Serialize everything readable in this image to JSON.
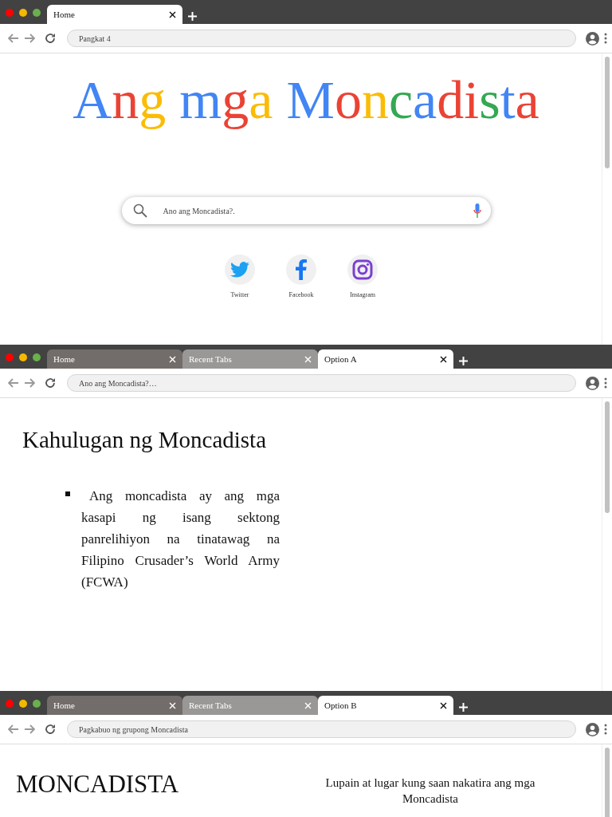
{
  "windows": [
    {
      "tabs": [
        {
          "label": "Home",
          "selected": true,
          "color": "#ffffff"
        }
      ],
      "address": "Pangkat 4",
      "content": {
        "kind": "search",
        "logo": [
          {
            "letters": [
              {
                "text": "A",
                "color": "#4285f4"
              },
              {
                "text": "n",
                "color": "#ea4335"
              },
              {
                "text": "g",
                "color": "#fbbc05"
              }
            ]
          },
          {
            "letters": [
              {
                "text": "m",
                "color": "#4285f4"
              },
              {
                "text": "g",
                "color": "#ea4335"
              },
              {
                "text": "a",
                "color": "#fbbc05"
              }
            ]
          },
          {
            "letters": [
              {
                "text": "M",
                "color": "#4285f4"
              },
              {
                "text": "o",
                "color": "#ea4335"
              },
              {
                "text": "n",
                "color": "#fbbc05"
              },
              {
                "text": "c",
                "color": "#34a853"
              },
              {
                "text": "a",
                "color": "#4285f4"
              },
              {
                "text": "d",
                "color": "#ea4335"
              },
              {
                "text": "i",
                "color": "#ea4335"
              },
              {
                "text": "s",
                "color": "#34a853"
              },
              {
                "text": "t",
                "color": "#4285f4"
              },
              {
                "text": "a",
                "color": "#ea4335"
              }
            ]
          }
        ],
        "query": "Ano ang Moncadista?.",
        "shortcuts": [
          {
            "kind": "twitter",
            "label": "Twitter"
          },
          {
            "kind": "facebook",
            "label": "Facebook"
          },
          {
            "kind": "instagram",
            "label": "Instagram"
          }
        ]
      }
    },
    {
      "tabs": [
        {
          "label": "Home",
          "selected": false,
          "color": "#726d6b"
        },
        {
          "label": "Recent Tabs",
          "selected": false,
          "color": "#9a9896"
        },
        {
          "label": "Option A",
          "selected": true,
          "color": "#ffffff"
        }
      ],
      "address": "Ano ang Moncadista?…",
      "content": {
        "kind": "article",
        "title": "Kahulugan ng Moncadista",
        "bullets": [
          "Ang moncadista ay ang mga kasapi ng isang sektong panrelihiyon na tinatawag na Filipino Crusader’s World Army (FCWA)"
        ]
      }
    },
    {
      "tabs": [
        {
          "label": "Home",
          "selected": false,
          "color": "#726d6b"
        },
        {
          "label": "Recent Tabs",
          "selected": false,
          "color": "#9a9896"
        },
        {
          "label": "Option B",
          "selected": true,
          "color": "#ffffff"
        }
      ],
      "address": "Pagkabuo ng grupong Moncadista",
      "content": {
        "kind": "split",
        "heading": "MONCADISTA",
        "caption": "Lupain at lugar kung saan nakatira ang mga Moncadista"
      }
    }
  ]
}
